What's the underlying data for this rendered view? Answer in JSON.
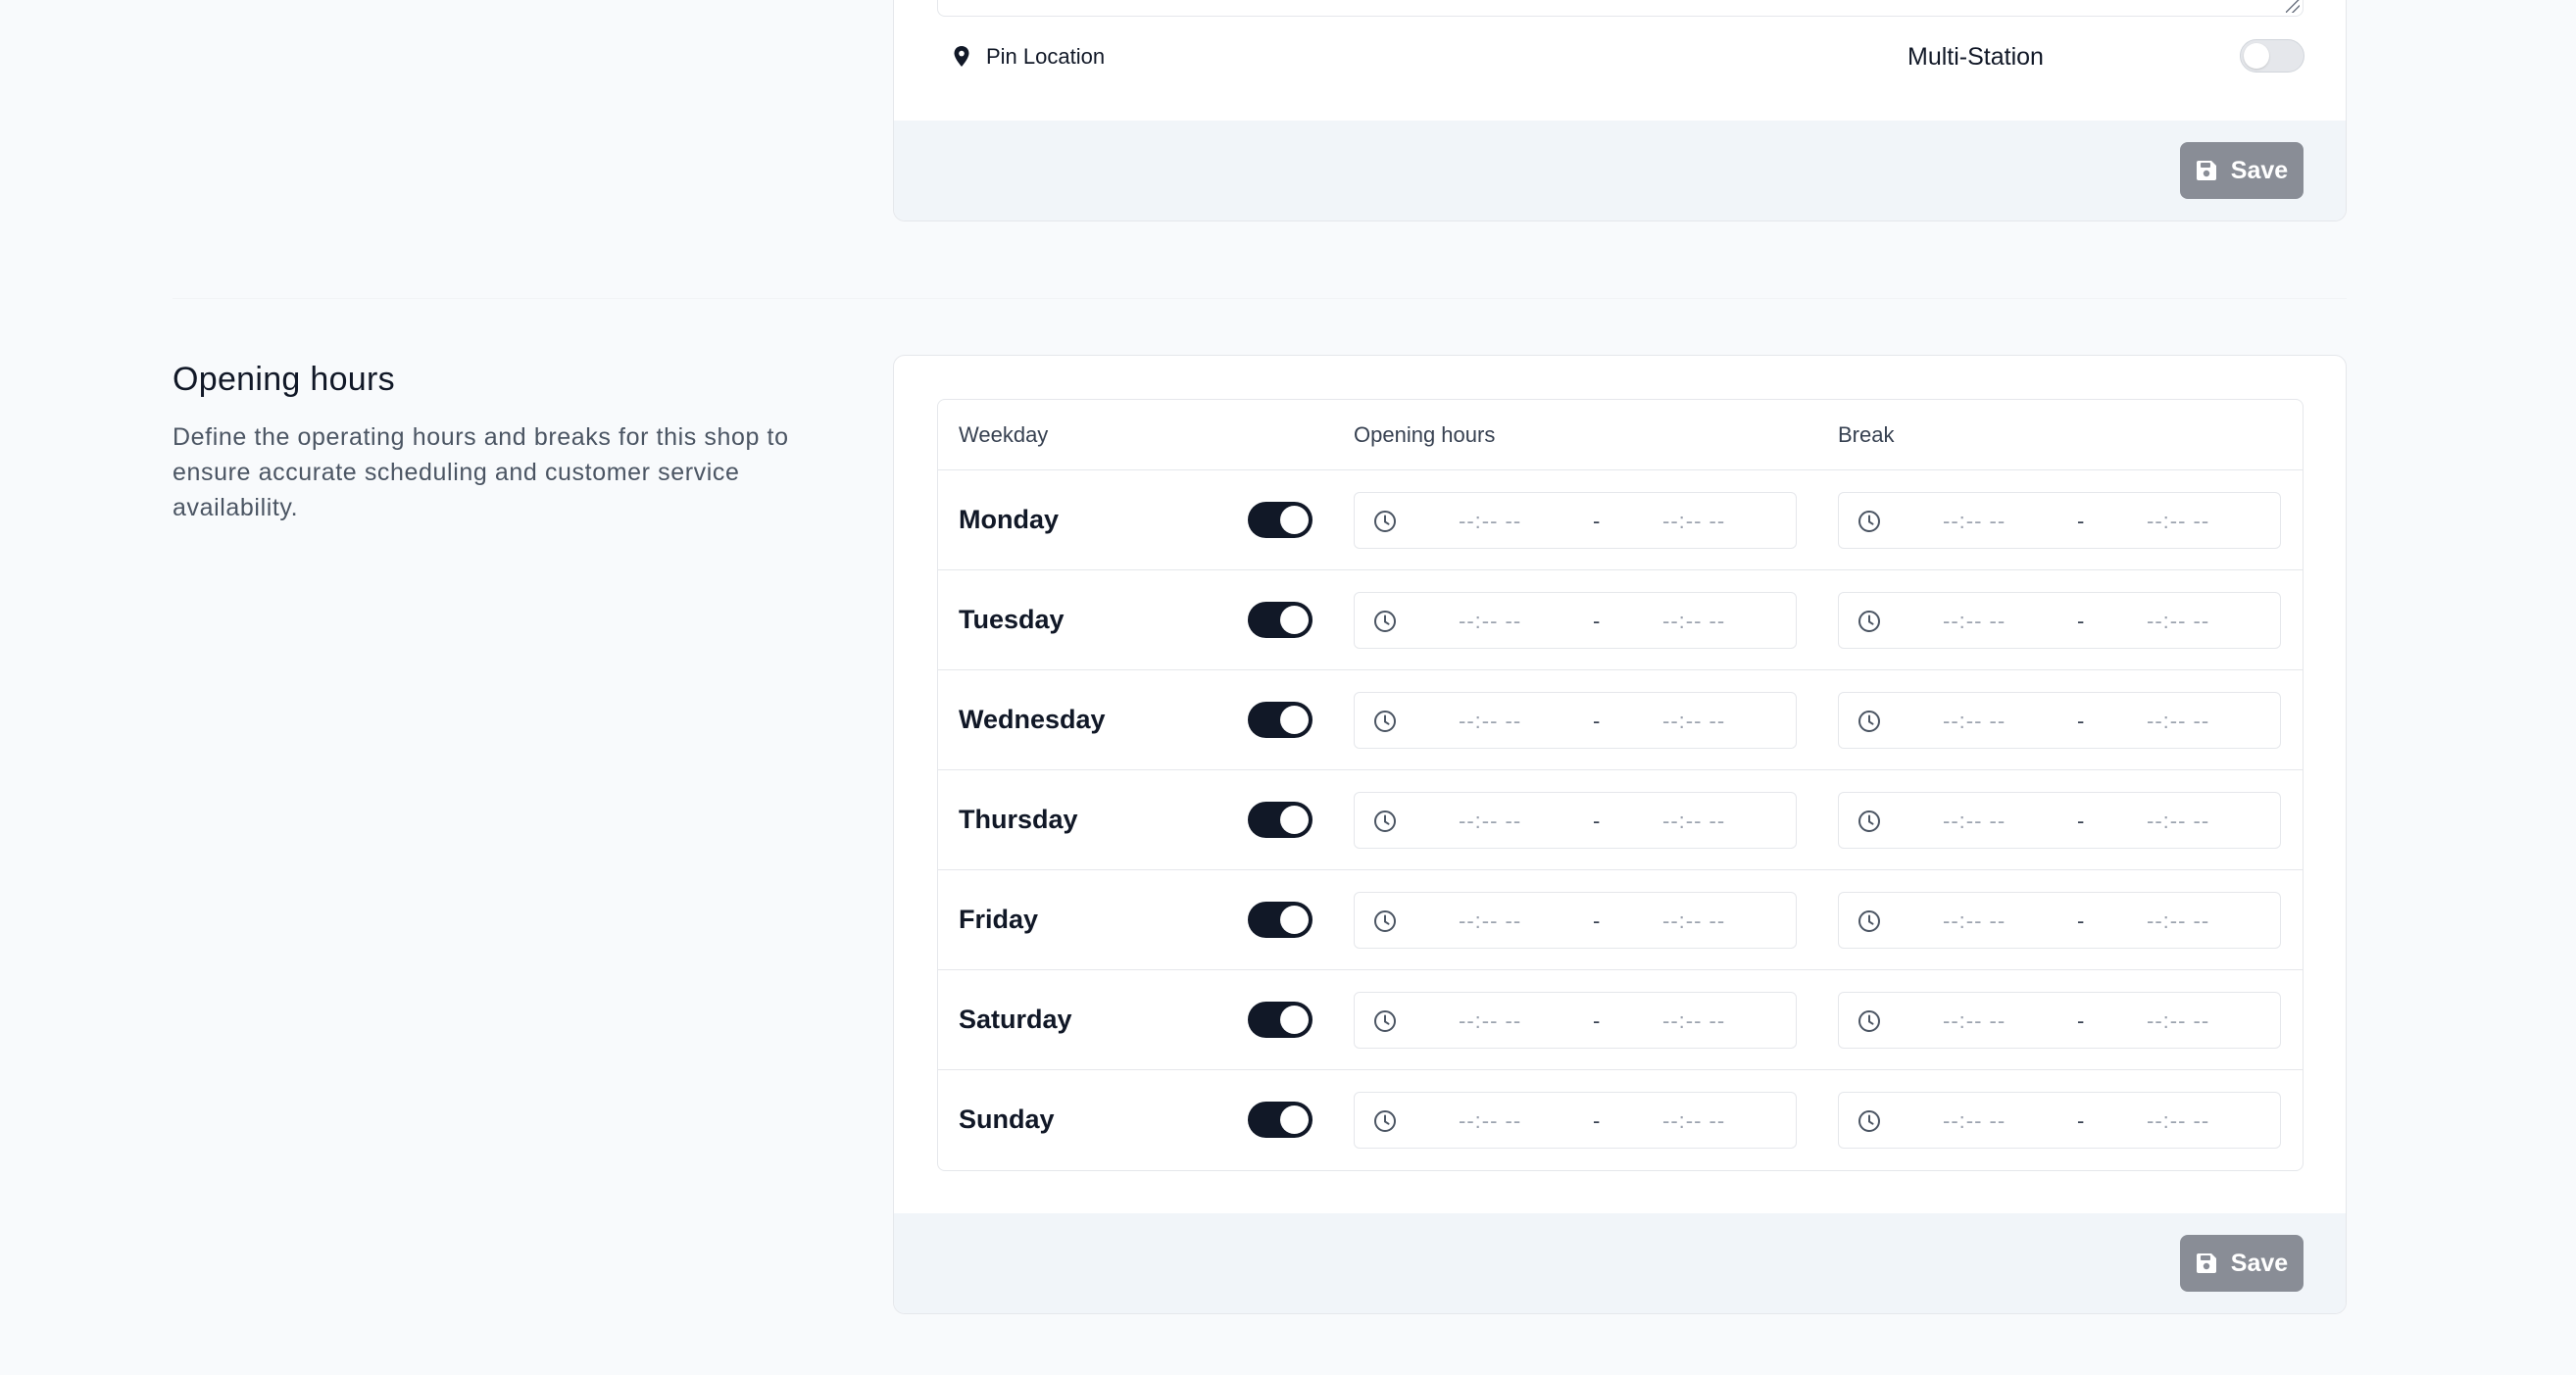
{
  "location_card": {
    "pin_location_label": "Pin Location",
    "multi_station_label": "Multi-Station",
    "multi_station_enabled": false,
    "save_label": "Save"
  },
  "opening_hours": {
    "title": "Opening hours",
    "description": "Define the operating hours and breaks for this shop to ensure accurate scheduling and customer service availability.",
    "columns": {
      "weekday": "Weekday",
      "opening_hours": "Opening hours",
      "break": "Break"
    },
    "time_placeholder": "--:-- --",
    "range_separator": "-",
    "days": [
      {
        "name": "Monday",
        "enabled": true
      },
      {
        "name": "Tuesday",
        "enabled": true
      },
      {
        "name": "Wednesday",
        "enabled": true
      },
      {
        "name": "Thursday",
        "enabled": true
      },
      {
        "name": "Friday",
        "enabled": true
      },
      {
        "name": "Saturday",
        "enabled": true
      },
      {
        "name": "Sunday",
        "enabled": true
      }
    ],
    "save_label": "Save"
  },
  "colors": {
    "toggle_on": "#111827",
    "toggle_off": "#e5e7eb",
    "save_button": "#898d96",
    "footer_bg": "#f1f5f9"
  }
}
